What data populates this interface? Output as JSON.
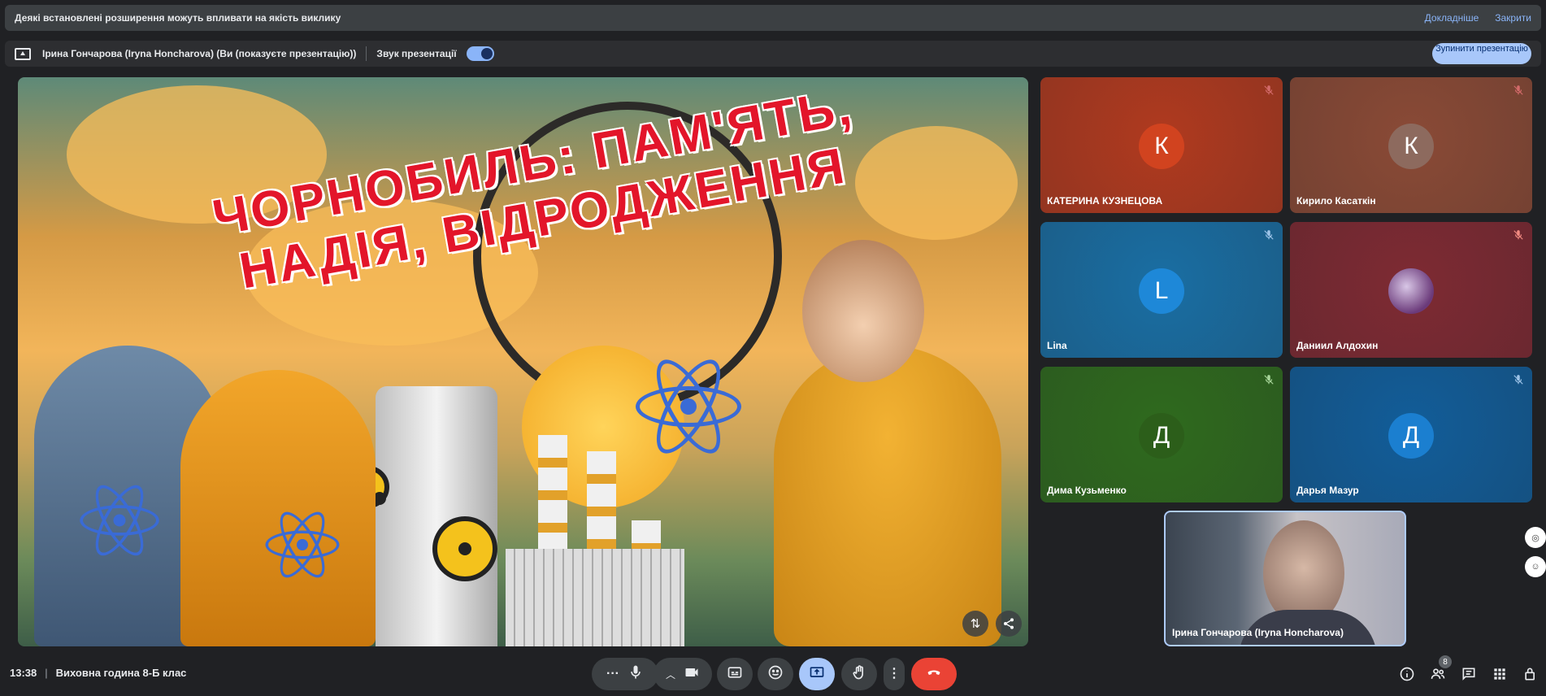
{
  "banner": {
    "message": "Деякі встановлені розширення можуть впливати на якість виклику",
    "learn_more": "Докладніше",
    "close": "Закрити"
  },
  "presenting_bar": {
    "presenter_text": "Ірина Гончарова (Iryna Honcharova) (Ви (показуєте презентацію))",
    "audio_label": "Звук презентації",
    "audio_enabled": true,
    "stop_button": "Зупинити презентацію"
  },
  "slide": {
    "title": "ЧОРНОБИЛЬ: ПАМ'ЯТЬ, НАДІЯ, ВІДРОДЖЕННЯ"
  },
  "participants": [
    {
      "name": "КАТЕРИНА КУЗНЕЦОВА",
      "initial": "К",
      "tile_color": "#b03a1f",
      "avatar_color": "#d1431f",
      "muted": true
    },
    {
      "name": "Кирило Касаткін",
      "initial": "К",
      "tile_color": "#8a4a36",
      "avatar_color": "#8d6a5e",
      "muted": true
    },
    {
      "name": "Lina",
      "initial": "L",
      "tile_color": "#1a6ea3",
      "avatar_color": "#1e88d8",
      "muted": true
    },
    {
      "name": "Даниил Алдохин",
      "initial": "",
      "tile_color": "#7e2a33",
      "avatar_color": "#6b3a7a",
      "muted": true
    },
    {
      "name": "Дима Кузьменко",
      "initial": "Д",
      "tile_color": "#2f6a1e",
      "avatar_color": "#2c5e1a",
      "muted": true
    },
    {
      "name": "Дарья Мазур",
      "initial": "Д",
      "tile_color": "#125d99",
      "avatar_color": "#1b7fd0",
      "muted": true
    }
  ],
  "self_view": {
    "name": "Ірина Гончарова (Iryna Honcharova)"
  },
  "bottom_bar": {
    "time": "13:38",
    "meeting_title": "Виховна година 8-Б клас",
    "participants_count": "8"
  },
  "icons": {
    "more": "more-options-icon",
    "mic": "microphone-icon",
    "camera": "camera-icon",
    "captions": "captions-icon",
    "emoji": "emoji-icon",
    "present": "present-screen-icon",
    "hand": "raise-hand-icon",
    "end": "end-call-icon",
    "info": "info-icon",
    "people": "people-icon",
    "chat": "chat-icon",
    "activities": "activities-icon",
    "lock": "host-controls-icon"
  },
  "colors": {
    "accent": "#a8c7fa",
    "end_call": "#ea4335",
    "background": "#202124"
  }
}
